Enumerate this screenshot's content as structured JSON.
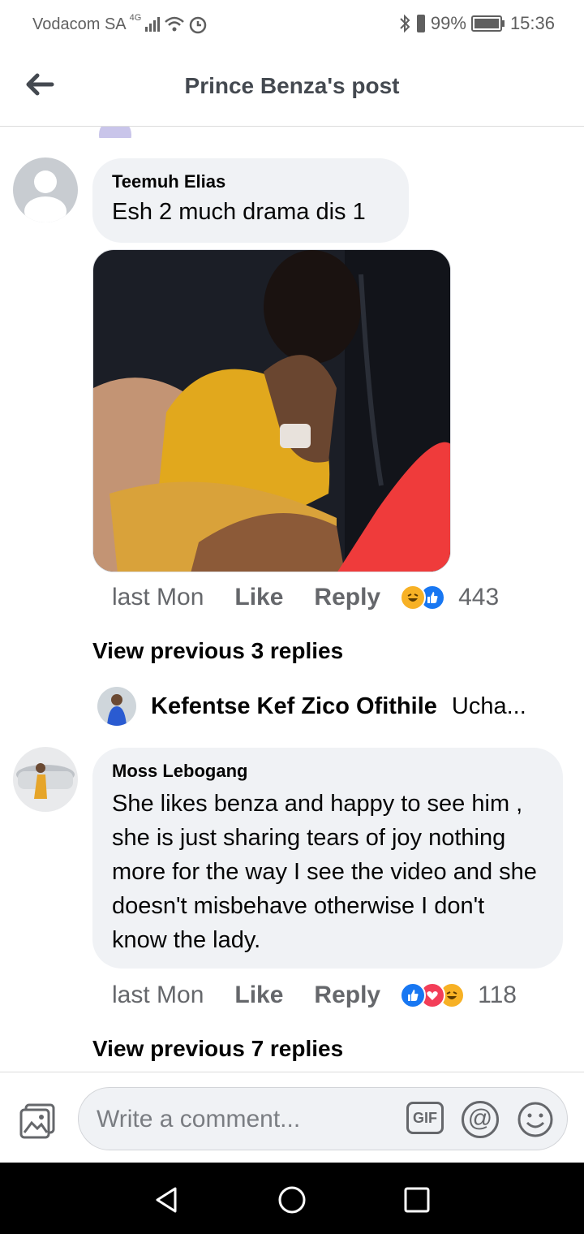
{
  "status": {
    "carrier": "Vodacom SA",
    "network": "4G",
    "battery": "99%",
    "time": "15:36"
  },
  "header": {
    "title": "Prince Benza's post"
  },
  "comments": [
    {
      "author": "Teemuh  Elias",
      "text": "Esh 2 much drama dis 1",
      "time": "last Mon",
      "like": "Like",
      "reply": "Reply",
      "reaction_count": "443",
      "view_previous": "View previous 3 replies"
    },
    {
      "author": "Moss Lebogang",
      "text": "She likes benza and happy to see him , she is just sharing tears of joy nothing more for the way I see the video and she doesn't misbehave otherwise I don't know the lady.",
      "time": "last Mon",
      "like": "Like",
      "reply": "Reply",
      "reaction_count": "118",
      "view_previous": "View previous 7 replies"
    }
  ],
  "reply_preview": {
    "author": "Kefentse Kef Zico Ofithile",
    "snippet": "Ucha..."
  },
  "composer": {
    "placeholder": "Write a comment...",
    "gif": "GIF",
    "at": "@"
  },
  "colors": {
    "bubble": "#f0f2f5",
    "muted": "#65676b",
    "like_blue": "#1877f2",
    "love_red": "#f33e58",
    "haha_yellow": "#f7b125"
  }
}
